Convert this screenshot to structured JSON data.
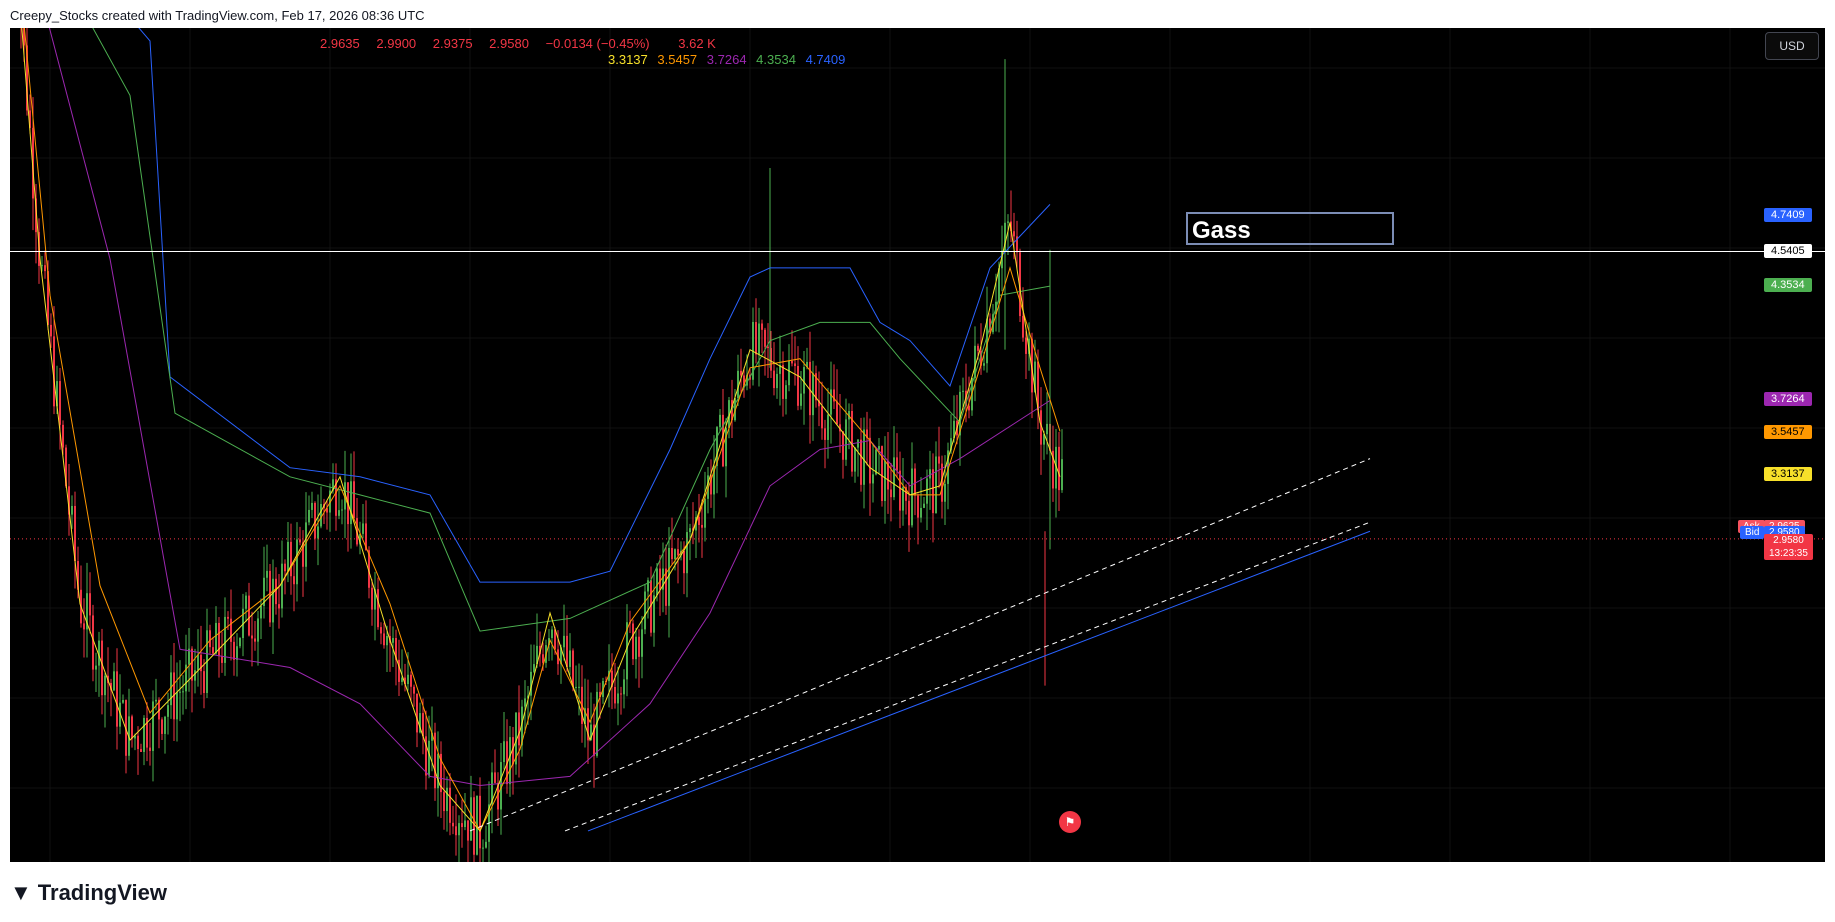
{
  "credit": "Creepy_Stocks created with TradingView.com, Feb 17, 2026 08:36 UTC",
  "ohlc": [
    "2.9635",
    "2.9900",
    "2.9375",
    "2.9580",
    "−0.0134 (−0.45%)",
    "3.62 K"
  ],
  "ma_values": [
    {
      "text": "3.3137",
      "color": "#f7e02a"
    },
    {
      "text": "3.5457",
      "color": "#ff9800"
    },
    {
      "text": "3.7264",
      "color": "#9c27b0"
    },
    {
      "text": "4.3534",
      "color": "#4caf50"
    },
    {
      "text": "4.7409",
      "color": "#2962ff"
    }
  ],
  "currency": "USD",
  "annotation": "Gass",
  "price_tags": [
    {
      "text": "4.7409",
      "color": "#2962ff",
      "price": 4.7409,
      "text_color": "#ffffff"
    },
    {
      "text": "4.5405",
      "color": "#ffffff",
      "price": 4.5405,
      "text_color": "#000000"
    },
    {
      "text": "4.3534",
      "color": "#4caf50",
      "price": 4.3534,
      "text_color": "#ffffff"
    },
    {
      "text": "3.7264",
      "color": "#9c27b0",
      "price": 3.7264,
      "text_color": "#ffffff"
    },
    {
      "text": "3.5457",
      "color": "#ff9800",
      "price": 3.5457,
      "text_color": "#000000"
    },
    {
      "text": "3.3137",
      "color": "#f7e02a",
      "price": 3.3137,
      "text_color": "#000000"
    }
  ],
  "ask": {
    "label": "Ask",
    "value": "2.9625",
    "color": "#f7525f"
  },
  "bid": {
    "label": "Bid",
    "value": "2.9580",
    "color": "#2962ff"
  },
  "last": {
    "value": "2.9580",
    "countdown": "13:23:35",
    "color": "#f23645"
  },
  "brand": "TradingView",
  "chart_data": {
    "type": "candlestick",
    "ylim": [
      1.3,
      5.65
    ],
    "horizontal_line": 4.5405,
    "last_price": 2.958,
    "series": [
      {
        "name": "",
        "color": "#2962ff",
        "values": [
          [
            0,
            6.6
          ],
          [
            140,
            5.7
          ],
          [
            160,
            3.85
          ],
          [
            280,
            3.35
          ],
          [
            350,
            3.3
          ],
          [
            420,
            3.2
          ],
          [
            470,
            2.72
          ],
          [
            560,
            2.72
          ],
          [
            600,
            2.78
          ],
          [
            660,
            3.45
          ],
          [
            700,
            3.95
          ],
          [
            740,
            4.4
          ],
          [
            760,
            4.45
          ],
          [
            840,
            4.45
          ],
          [
            870,
            4.15
          ],
          [
            900,
            4.05
          ],
          [
            940,
            3.8
          ],
          [
            980,
            4.45
          ],
          [
            1040,
            4.8
          ]
        ]
      },
      {
        "name": "",
        "color": "#4caf50",
        "values": [
          [
            0,
            6.6
          ],
          [
            120,
            5.4
          ],
          [
            165,
            3.65
          ],
          [
            280,
            3.3
          ],
          [
            350,
            3.2
          ],
          [
            420,
            3.1
          ],
          [
            470,
            2.45
          ],
          [
            560,
            2.52
          ],
          [
            640,
            2.72
          ],
          [
            700,
            3.45
          ],
          [
            760,
            4.05
          ],
          [
            810,
            4.15
          ],
          [
            860,
            4.15
          ],
          [
            890,
            3.95
          ],
          [
            950,
            3.6
          ],
          [
            990,
            4.3
          ],
          [
            1040,
            4.35
          ]
        ]
      },
      {
        "name": "",
        "color": "#9c27b0",
        "values": [
          [
            0,
            6.6
          ],
          [
            100,
            4.5
          ],
          [
            170,
            2.35
          ],
          [
            280,
            2.25
          ],
          [
            350,
            2.05
          ],
          [
            420,
            1.65
          ],
          [
            470,
            1.6
          ],
          [
            560,
            1.65
          ],
          [
            640,
            2.05
          ],
          [
            700,
            2.55
          ],
          [
            760,
            3.25
          ],
          [
            810,
            3.45
          ],
          [
            860,
            3.5
          ],
          [
            900,
            3.25
          ],
          [
            950,
            3.4
          ],
          [
            1040,
            3.72
          ]
        ]
      },
      {
        "name": "",
        "color": "#ff9800",
        "values": [
          [
            0,
            6.6
          ],
          [
            40,
            4.3
          ],
          [
            90,
            2.7
          ],
          [
            140,
            2.0
          ],
          [
            200,
            2.4
          ],
          [
            270,
            2.7
          ],
          [
            330,
            3.25
          ],
          [
            380,
            2.6
          ],
          [
            430,
            1.75
          ],
          [
            470,
            1.35
          ],
          [
            510,
            1.8
          ],
          [
            540,
            2.4
          ],
          [
            580,
            1.95
          ],
          [
            620,
            2.5
          ],
          [
            680,
            2.95
          ],
          [
            740,
            3.9
          ],
          [
            790,
            3.95
          ],
          [
            860,
            3.5
          ],
          [
            900,
            3.2
          ],
          [
            930,
            3.2
          ],
          [
            970,
            3.9
          ],
          [
            1000,
            4.45
          ],
          [
            1030,
            3.9
          ],
          [
            1050,
            3.55
          ]
        ]
      },
      {
        "name": "",
        "color": "#f7e02a",
        "values": [
          [
            0,
            6.6
          ],
          [
            30,
            4.5
          ],
          [
            70,
            2.6
          ],
          [
            120,
            1.85
          ],
          [
            200,
            2.3
          ],
          [
            270,
            2.7
          ],
          [
            330,
            3.3
          ],
          [
            380,
            2.4
          ],
          [
            430,
            1.6
          ],
          [
            470,
            1.35
          ],
          [
            510,
            1.9
          ],
          [
            540,
            2.55
          ],
          [
            580,
            1.85
          ],
          [
            620,
            2.4
          ],
          [
            680,
            2.95
          ],
          [
            740,
            4.0
          ],
          [
            790,
            3.85
          ],
          [
            860,
            3.35
          ],
          [
            900,
            3.2
          ],
          [
            930,
            3.25
          ],
          [
            970,
            4.0
          ],
          [
            1000,
            4.7
          ],
          [
            1030,
            3.6
          ],
          [
            1050,
            3.3
          ]
        ]
      }
    ],
    "trendlines": [
      {
        "color": "#2962ff",
        "dashed": false,
        "from": [
          578,
          1.35
        ],
        "to": [
          1360,
          3.0
        ]
      },
      {
        "color": "#ffffff",
        "dashed": true,
        "from": [
          555,
          1.35
        ],
        "to": [
          1360,
          3.05
        ]
      },
      {
        "color": "#ffffff",
        "dashed": true,
        "from": [
          460,
          1.35
        ],
        "to": [
          1360,
          3.4
        ]
      }
    ]
  }
}
